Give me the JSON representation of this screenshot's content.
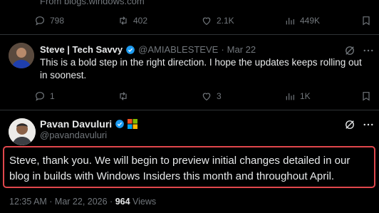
{
  "top_tweet": {
    "source_text": "From blogs.windows.com",
    "replies": "798",
    "retweets": "402",
    "likes": "2.1K",
    "views": "449K"
  },
  "reply": {
    "author_name": "Steve | Tech Savvy",
    "handle": "@AMIABLESTEVE",
    "separator": "·",
    "date": "Mar 22",
    "text": "This is a bold step in the right direction. I hope the updates keeps rolling out in soonest.",
    "replies": "1",
    "retweets": "",
    "likes": "3",
    "views": "1K"
  },
  "main_post": {
    "author_name": "Pavan Davuluri",
    "handle": "@pavandavuluri",
    "text": "Steve, thank you. We will begin to preview initial changes detailed in our blog in builds with Windows Insiders this month and throughout April.",
    "timestamp": "12:35 AM · Mar 22, 2026 · ",
    "views_count": "964",
    "views_label": " Views"
  },
  "colors": {
    "background": "#000000",
    "text": "#e7e9ea",
    "muted": "#71767b",
    "verified": "#1d9bf0",
    "highlight_border": "#e0474c",
    "divider": "#2f3336"
  },
  "icons": [
    "reply-icon",
    "retweet-icon",
    "like-icon",
    "views-icon",
    "bookmark-icon",
    "share-icon",
    "grok-icon",
    "more-icon",
    "verified-icon",
    "affiliate-badge-icon"
  ]
}
